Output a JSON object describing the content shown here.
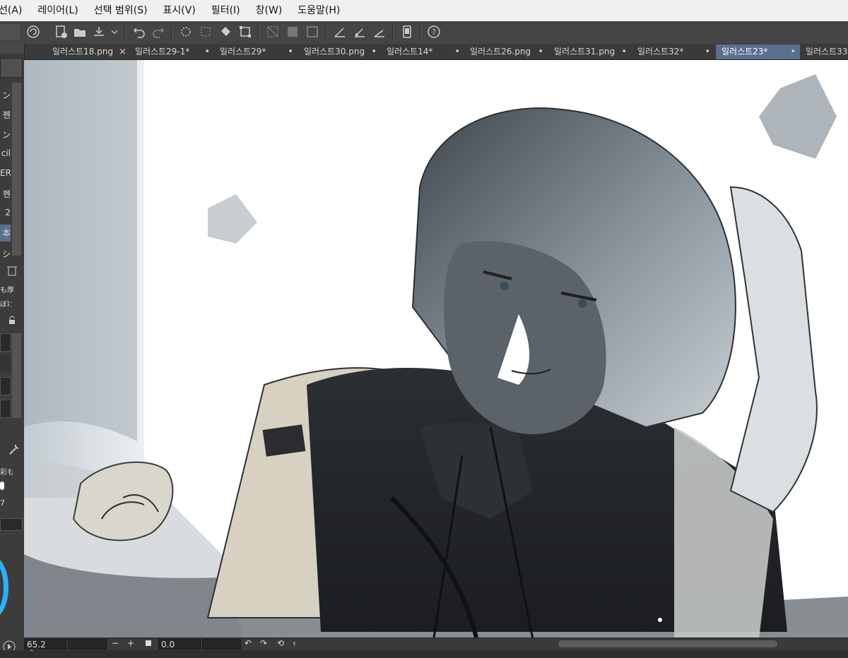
{
  "menu": [
    "선(A)",
    "레이어(L)",
    "선택 범위(S)",
    "표시(V)",
    "필터(I)",
    "창(W)",
    "도움말(H)"
  ],
  "toolbar_icons": [
    "clip-studio-icon",
    "new-file-icon",
    "open-file-icon",
    "save-icon",
    "dropdown-icon",
    "undo-icon",
    "redo-icon",
    "clear-icon",
    "fill-selection-icon",
    "bucket-icon",
    "transform-icon",
    "hide-selection-icon",
    "selection-fill-icon",
    "border-icon",
    "pen-settings-icon",
    "brush-settings-icon",
    "ruler-settings-icon",
    "smartphone-icon",
    "help-icon"
  ],
  "tabs": [
    {
      "label": "일러스트18.png",
      "mark": "×",
      "active": false
    },
    {
      "label": "일러스트29-1*",
      "mark": "•",
      "active": false
    },
    {
      "label": "일러스트29*",
      "mark": "•",
      "active": false
    },
    {
      "label": "일러스트30.png",
      "mark": "•",
      "active": false
    },
    {
      "label": "일러스트14*",
      "mark": "•",
      "active": false
    },
    {
      "label": "일러스트26.png",
      "mark": "•",
      "active": false
    },
    {
      "label": "일러스트31.png",
      "mark": "•",
      "active": false
    },
    {
      "label": "일러스트32*",
      "mark": "•",
      "active": false
    },
    {
      "label": "일러스트23*",
      "mark": "•",
      "active": true
    },
    {
      "label": "일러스트33",
      "mark": "",
      "active": false
    }
  ],
  "left_panel": {
    "items": [
      "ン",
      "펜",
      "ン",
      "cil",
      "ER",
      "펜",
      "2",
      "本",
      "シ",
      "も厚",
      "ぼけも",
      "彩も",
      "7"
    ]
  },
  "status": {
    "zoom": "65.2",
    "minus": "−",
    "plus": "+",
    "angle": "0.0"
  },
  "colors": {
    "menubar_bg": "#f0f0f0",
    "toolbar_bg": "#454545",
    "active_tab": "#5a6f8e",
    "panel_bg": "#3c3c3c"
  },
  "canvas": {
    "subject": "digital-illustration-sketch"
  }
}
